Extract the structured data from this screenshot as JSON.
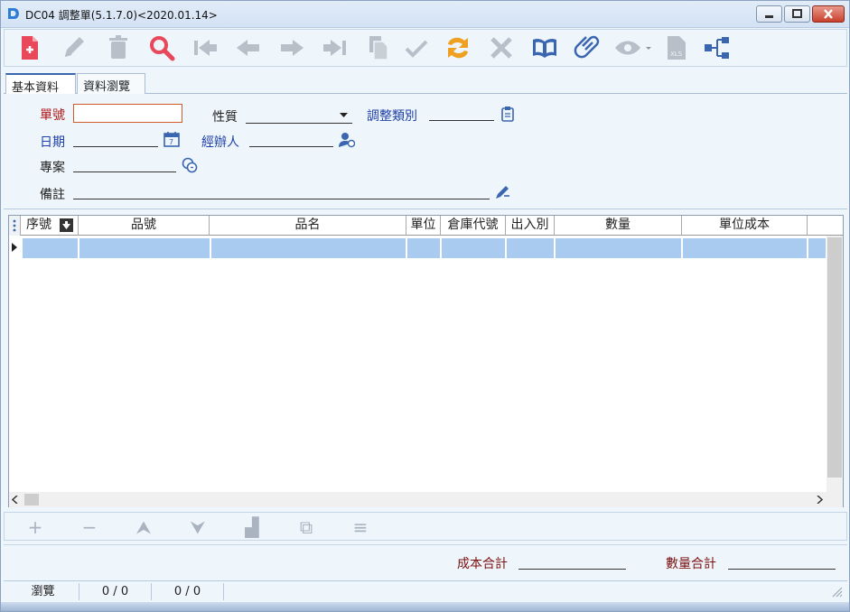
{
  "window": {
    "title": "DC04 調整單(5.1.7.0)<2020.01.14>"
  },
  "toolbar": {
    "buttons": [
      {
        "icon": "new-document-icon"
      },
      {
        "icon": "edit-pencil-icon"
      },
      {
        "icon": "delete-trash-icon"
      },
      {
        "icon": "search-icon"
      },
      {
        "icon": "first-record-icon"
      },
      {
        "icon": "previous-record-icon"
      },
      {
        "icon": "next-record-icon"
      },
      {
        "icon": "last-record-icon"
      },
      {
        "icon": "copy-icon"
      },
      {
        "icon": "confirm-check-icon"
      },
      {
        "icon": "refresh-icon"
      },
      {
        "icon": "cancel-x-icon"
      },
      {
        "icon": "book-icon"
      },
      {
        "icon": "attachment-clip-icon"
      },
      {
        "icon": "view-eye-icon"
      },
      {
        "icon": "excel-export-icon"
      },
      {
        "icon": "tree-structure-icon"
      }
    ]
  },
  "tabs": {
    "basic": "基本資料",
    "browse": "資料瀏覽"
  },
  "form": {
    "doc_no_label": "單號",
    "doc_no_value": "",
    "nature_label": "性質",
    "nature_value": "",
    "adjust_type_label": "調整類別",
    "adjust_type_value": "",
    "date_label": "日期",
    "date_value": "",
    "handler_label": "經辦人",
    "handler_value": "",
    "project_label": "專案",
    "project_value": "",
    "remark_label": "備註",
    "remark_value": ""
  },
  "grid": {
    "columns": [
      "序號",
      "品號",
      "品名",
      "單位",
      "倉庫代號",
      "出入別",
      "數量",
      "單位成本"
    ],
    "rows": [
      [
        "",
        "",
        "",
        "",
        "",
        "",
        "",
        ""
      ]
    ],
    "vscroll_position": 0,
    "hscroll_position": 0
  },
  "row_buttons": [
    {
      "icon": "add-row-icon",
      "glyph": "+"
    },
    {
      "icon": "remove-row-icon",
      "glyph": "−"
    },
    {
      "icon": "move-up-icon",
      "glyph": "⮝"
    },
    {
      "icon": "move-down-icon",
      "glyph": "⮟"
    },
    {
      "icon": "stack-icon",
      "glyph": "▟"
    },
    {
      "icon": "paste-icon",
      "glyph": "⧉"
    },
    {
      "icon": "menu-lines-icon",
      "glyph": "≡"
    }
  ],
  "totals": {
    "cost_label": "成本合計",
    "cost_value": "",
    "qty_label": "數量合計",
    "qty_value": ""
  },
  "status": {
    "mode": "瀏覽",
    "count1": "0 / 0",
    "count2": "0 / 0"
  },
  "colors": {
    "accent_red": "#e8485a",
    "accent_blue": "#3a66b0",
    "row_selected": "#a9cbf0",
    "label_blue": "#1d3fa8",
    "label_red": "#b01818"
  }
}
